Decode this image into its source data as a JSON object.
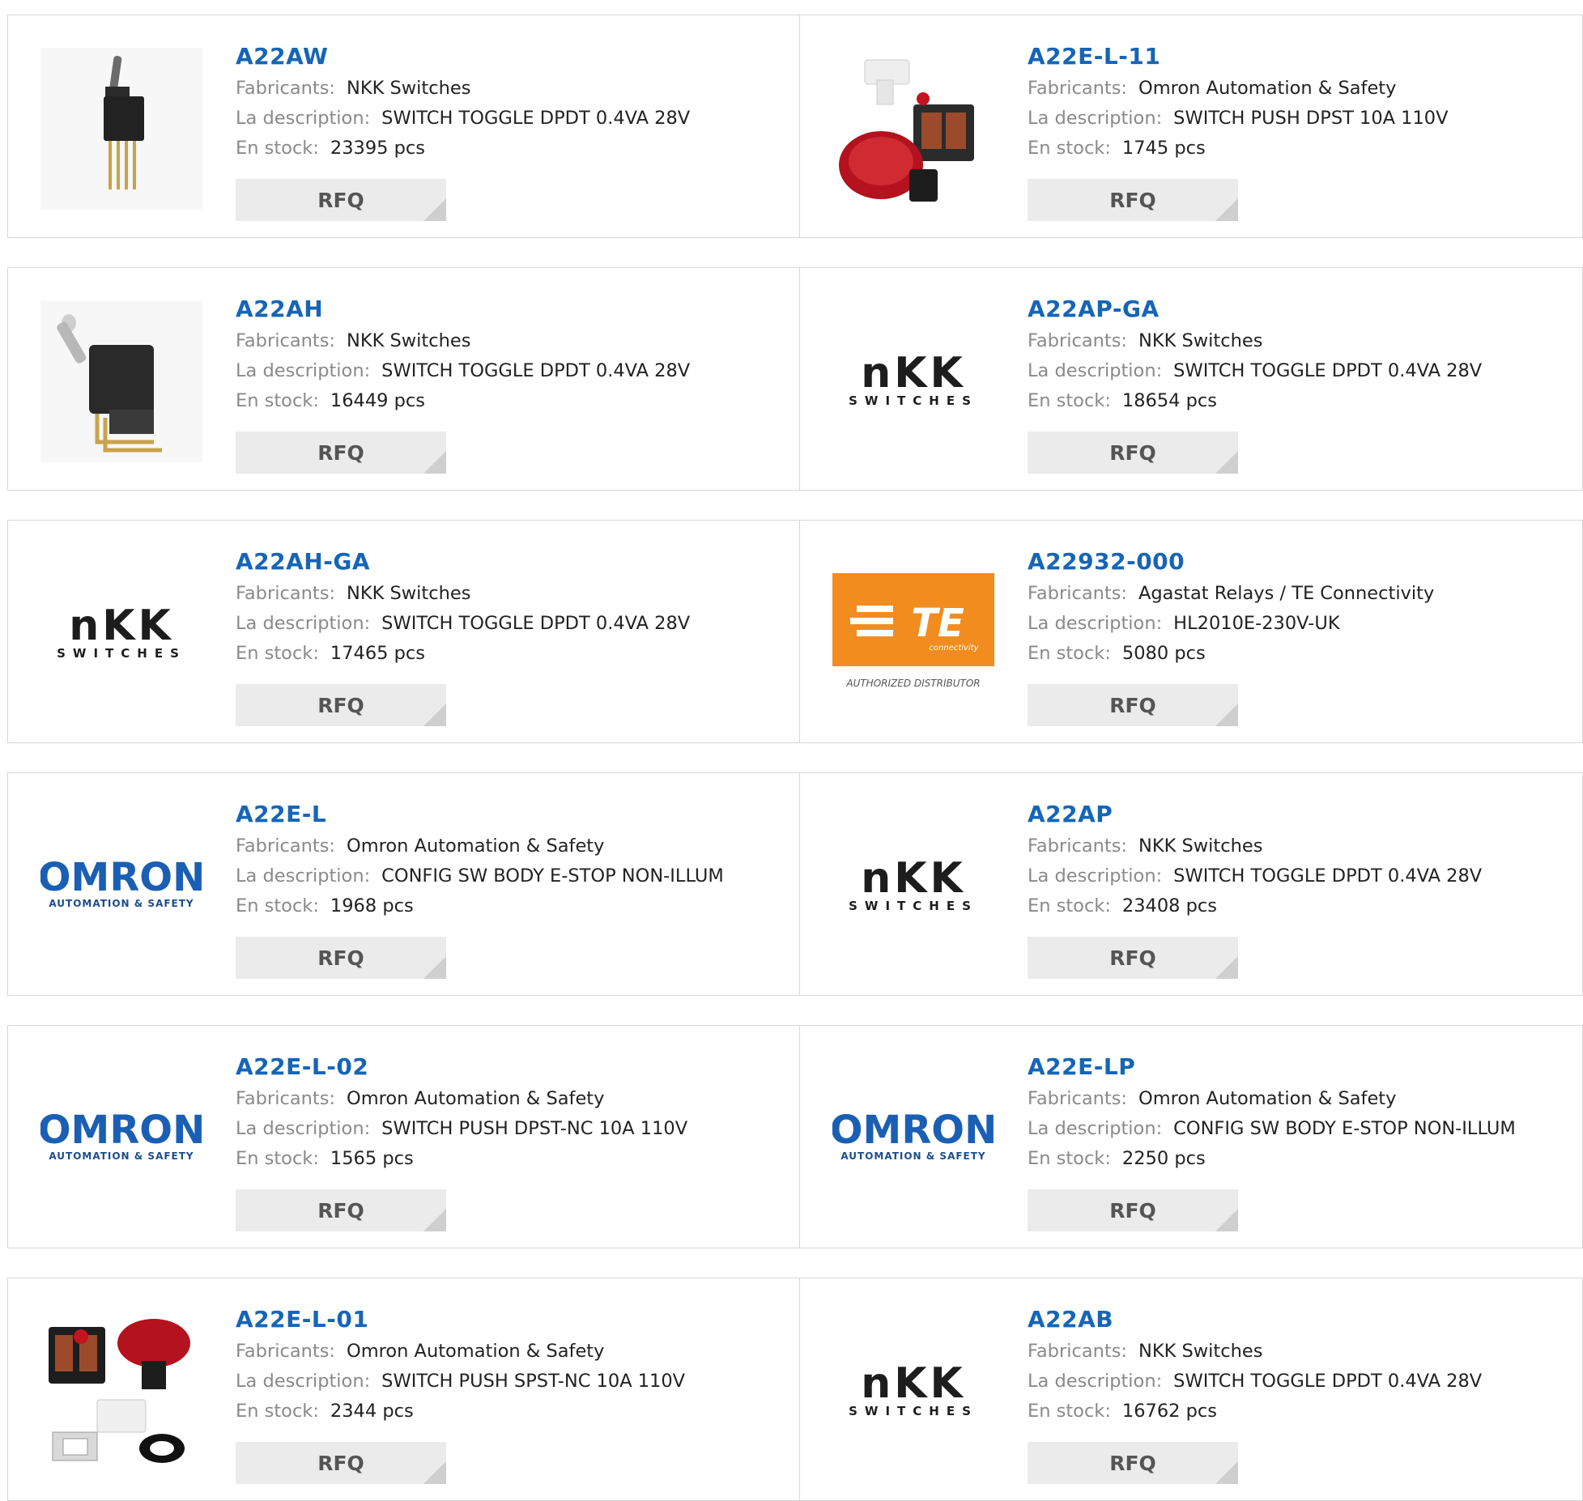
{
  "products": [
    {
      "part": "A22AW",
      "fab_label": "Fabricants:",
      "fab": "NKK Switches",
      "desc_label": "La description:",
      "desc": "SWITCH TOGGLE DPDT 0.4VA 28V",
      "stock_label": "En stock:",
      "stock": "23395 pcs",
      "rfq": "RFQ",
      "image": "toggle-switch-photo"
    },
    {
      "part": "A22E-L-11",
      "fab_label": "Fabricants:",
      "fab": "Omron Automation & Safety",
      "desc_label": "La description:",
      "desc": "SWITCH PUSH DPST 10A 110V",
      "stock_label": "En stock:",
      "stock": "1745 pcs",
      "rfq": "RFQ",
      "image": "estop-assembly-photo"
    },
    {
      "part": "A22AH",
      "fab_label": "Fabricants:",
      "fab": "NKK Switches",
      "desc_label": "La description:",
      "desc": "SWITCH TOGGLE DPDT 0.4VA 28V",
      "stock_label": "En stock:",
      "stock": "16449 pcs",
      "rfq": "RFQ",
      "image": "right-angle-toggle-photo"
    },
    {
      "part": "A22AP-GA",
      "fab_label": "Fabricants:",
      "fab": "NKK Switches",
      "desc_label": "La description:",
      "desc": "SWITCH TOGGLE DPDT 0.4VA 28V",
      "stock_label": "En stock:",
      "stock": "18654 pcs",
      "rfq": "RFQ",
      "image": "nkk-logo"
    },
    {
      "part": "A22AH-GA",
      "fab_label": "Fabricants:",
      "fab": "NKK Switches",
      "desc_label": "La description:",
      "desc": "SWITCH TOGGLE DPDT 0.4VA 28V",
      "stock_label": "En stock:",
      "stock": "17465 pcs",
      "rfq": "RFQ",
      "image": "nkk-logo"
    },
    {
      "part": "A22932-000",
      "fab_label": "Fabricants:",
      "fab": "Agastat Relays / TE Connectivity",
      "desc_label": "La description:",
      "desc": "HL2010E-230V-UK",
      "stock_label": "En stock:",
      "stock": "5080 pcs",
      "rfq": "RFQ",
      "image": "te-logo"
    },
    {
      "part": "A22E-L",
      "fab_label": "Fabricants:",
      "fab": "Omron Automation & Safety",
      "desc_label": "La description:",
      "desc": "CONFIG SW BODY E-STOP NON-ILLUM",
      "stock_label": "En stock:",
      "stock": "1968 pcs",
      "rfq": "RFQ",
      "image": "omron-logo"
    },
    {
      "part": "A22AP",
      "fab_label": "Fabricants:",
      "fab": "NKK Switches",
      "desc_label": "La description:",
      "desc": "SWITCH TOGGLE DPDT 0.4VA 28V",
      "stock_label": "En stock:",
      "stock": "23408 pcs",
      "rfq": "RFQ",
      "image": "nkk-logo"
    },
    {
      "part": "A22E-L-02",
      "fab_label": "Fabricants:",
      "fab": "Omron Automation & Safety",
      "desc_label": "La description:",
      "desc": "SWITCH PUSH DPST-NC 10A 110V",
      "stock_label": "En stock:",
      "stock": "1565 pcs",
      "rfq": "RFQ",
      "image": "omron-logo"
    },
    {
      "part": "A22E-LP",
      "fab_label": "Fabricants:",
      "fab": "Omron Automation & Safety",
      "desc_label": "La description:",
      "desc": "CONFIG SW BODY E-STOP NON-ILLUM",
      "stock_label": "En stock:",
      "stock": "2250 pcs",
      "rfq": "RFQ",
      "image": "omron-logo"
    },
    {
      "part": "A22E-L-01",
      "fab_label": "Fabricants:",
      "fab": "Omron Automation & Safety",
      "desc_label": "La description:",
      "desc": "SWITCH PUSH SPST-NC 10A 110V",
      "stock_label": "En stock:",
      "stock": "2344 pcs",
      "rfq": "RFQ",
      "image": "estop-parts-photo"
    },
    {
      "part": "A22AB",
      "fab_label": "Fabricants:",
      "fab": "NKK Switches",
      "desc_label": "La description:",
      "desc": "SWITCH TOGGLE DPDT 0.4VA 28V",
      "stock_label": "En stock:",
      "stock": "16762 pcs",
      "rfq": "RFQ",
      "image": "nkk-logo"
    }
  ],
  "logos": {
    "nkk_word": "nKK",
    "nkk_sub": "SWITCHES",
    "omron_word": "OMRON",
    "omron_sub": "AUTOMATION & SAFETY",
    "te_word": "TE",
    "te_sub": "connectivity",
    "te_caption": "AUTHORIZED DISTRIBUTOR"
  },
  "colors": {
    "part_link": "#1565b8",
    "label_gray": "#8a8a8a",
    "value_text": "#222222",
    "rfq_bg": "#ebebeb",
    "border": "#d7d7d7",
    "omron_blue": "#1a5fb4",
    "te_orange": "#f28c1e",
    "estop_red": "#b3121e"
  }
}
